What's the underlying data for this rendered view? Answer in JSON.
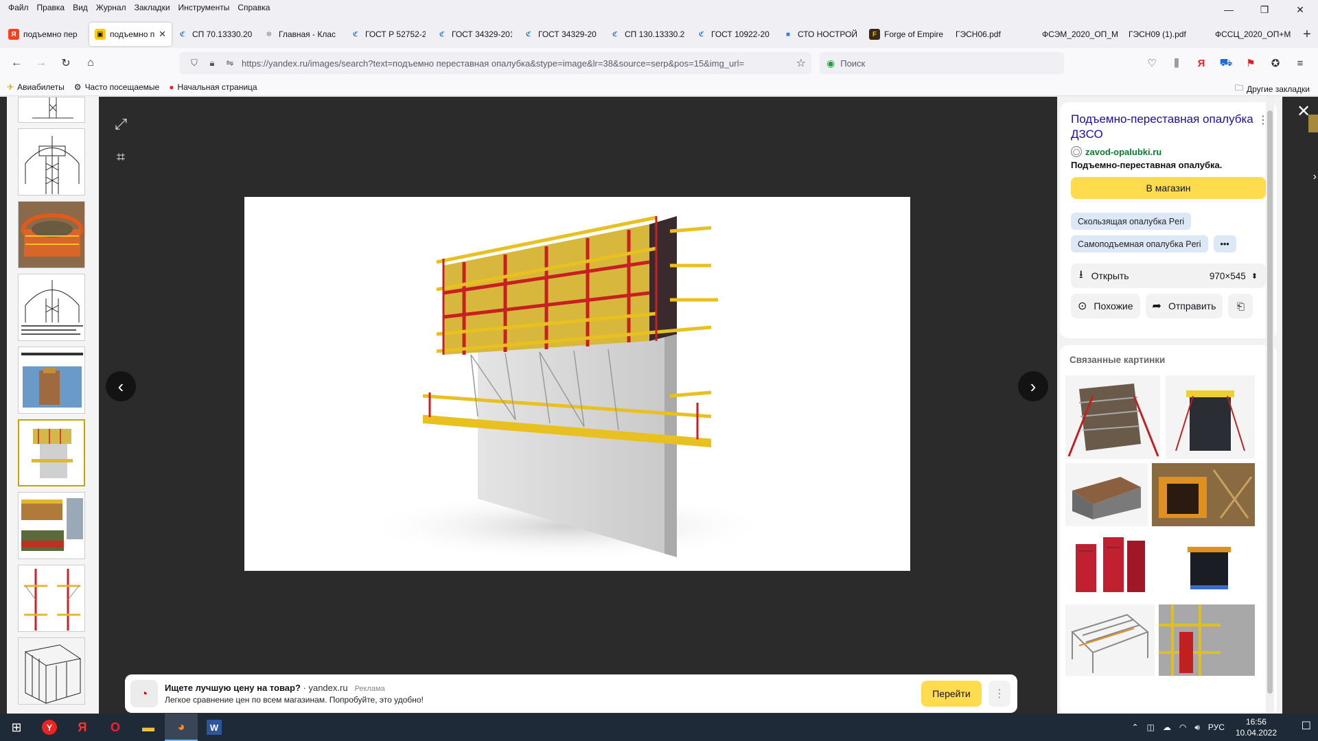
{
  "menu": [
    "Файл",
    "Правка",
    "Вид",
    "Журнал",
    "Закладки",
    "Инструменты",
    "Справка"
  ],
  "window_controls": {
    "minimize": "—",
    "restore": "❐",
    "close": "✕"
  },
  "tabs": [
    {
      "label": "подъемно пер",
      "fav": "Я",
      "fav_bg": "#fc3f1d",
      "fav_fg": "#ffffff"
    },
    {
      "label": "подъемно п",
      "fav": "▣",
      "fav_bg": "#ffcc00",
      "fav_fg": "#111111",
      "active": true
    },
    {
      "label": "СП 70.13330.20",
      "fav": "ℭ",
      "fav_bg": "transparent",
      "fav_fg": "#1a6fd1"
    },
    {
      "label": "Главная - Клас",
      "fav": "✲",
      "fav_bg": "transparent",
      "fav_fg": "#777777"
    },
    {
      "label": "ГОСТ Р 52752-2",
      "fav": "ℭ",
      "fav_bg": "transparent",
      "fav_fg": "#1a6fd1"
    },
    {
      "label": "ГОСТ 34329-201",
      "fav": "ℭ",
      "fav_bg": "transparent",
      "fav_fg": "#1a6fd1"
    },
    {
      "label": "ГОСТ 34329-20",
      "fav": "ℭ",
      "fav_bg": "transparent",
      "fav_fg": "#1a6fd1"
    },
    {
      "label": "СП 130.13330.2",
      "fav": "ℭ",
      "fav_bg": "transparent",
      "fav_fg": "#1a6fd1"
    },
    {
      "label": "ГОСТ 10922-20",
      "fav": "ℭ",
      "fav_bg": "transparent",
      "fav_fg": "#1a6fd1"
    },
    {
      "label": "СТО НОСТРОЙ",
      "fav": "■",
      "fav_bg": "transparent",
      "fav_fg": "#3a7bd5"
    },
    {
      "label": "Forge of Empire",
      "fav": "F",
      "fav_bg": "#3a2a10",
      "fav_fg": "#e0b040"
    },
    {
      "label": "ГЭСН06.pdf",
      "fav": "",
      "fav_bg": "transparent",
      "fav_fg": "#333"
    },
    {
      "label": "ФСЭМ_2020_ОП_М",
      "fav": "",
      "fav_bg": "transparent",
      "fav_fg": "#333"
    },
    {
      "label": "ГЭСН09 (1).pdf",
      "fav": "",
      "fav_bg": "transparent",
      "fav_fg": "#333"
    },
    {
      "label": "ФССЦ_2020_ОП+М",
      "fav": "",
      "fav_bg": "transparent",
      "fav_fg": "#333"
    }
  ],
  "tab_close": "✕",
  "new_tab": "+",
  "nav": {
    "back": "←",
    "forward": "→",
    "reload": "↻",
    "home": "⌂"
  },
  "url": "https://yandex.ru/images/search?text=подъемно переставная опалубка&stype=image&lr=38&source=serp&pos=15&img_url=",
  "search_placeholder": "Поиск",
  "bookmarks": [
    {
      "label": "Авиабилеты",
      "icon": "✈"
    },
    {
      "label": "Часто посещаемые",
      "icon": "⚙"
    },
    {
      "label": "Начальная страница",
      "icon": "●"
    }
  ],
  "other_bookmarks": "Другие закладки",
  "ad": {
    "title": "Ищете лучшую цену на товар?",
    "source": "· yandex.ru",
    "label": "Реклама",
    "text": "Легкое сравнение цен по всем магазинам. Попробуйте, это удобно!",
    "button": "Перейти",
    "more": "⋮"
  },
  "panel": {
    "title": "Подъемно-переставная опалубка ДЗСО",
    "source": "zavod-opalubki.ru",
    "description": "Подъемно-переставная опалубка.",
    "shop_button": "В магазин",
    "chips": [
      "Скользящая опалубка Peri",
      "Самоподъемная опалубка Peri",
      "•••"
    ],
    "open_label": "Открыть",
    "size": "970×545",
    "similar_label": "Похожие",
    "share_label": "Отправить",
    "related_title": "Связанные картинки"
  },
  "taskbar": {
    "lang": "РУС",
    "time": "16:56",
    "date": "10.04.2022"
  },
  "colors": {
    "accent_yellow": "#ffdb4d",
    "link_blue": "#1a0dab",
    "source_green": "#0a7a2e",
    "viewer_bg": "#2b2b2b"
  }
}
